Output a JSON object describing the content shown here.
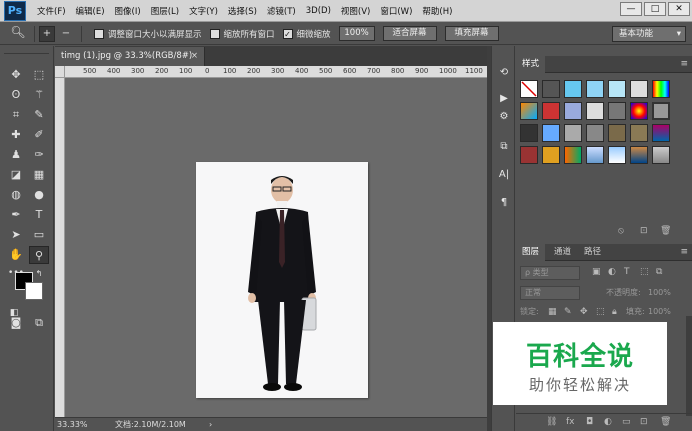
{
  "app": {
    "logo": "Ps"
  },
  "menu": [
    "文件(F)",
    "编辑(E)",
    "图像(I)",
    "图层(L)",
    "文字(Y)",
    "选择(S)",
    "滤镜(T)",
    "3D(D)",
    "视图(V)",
    "窗口(W)",
    "帮助(H)"
  ],
  "window_controls": {
    "minimize": "—",
    "maximize": "□",
    "close": "✕"
  },
  "options": {
    "resize_windows_label": "调整窗口大小以满屏显示",
    "resize_windows_checked": false,
    "zoom_all_label": "缩放所有窗口",
    "zoom_all_checked": false,
    "scrubby_zoom_label": "细微缩放",
    "scrubby_zoom_checked": true,
    "zoom_percent": "100%",
    "fit_screen_label": "适合屏幕",
    "fill_screen_label": "填充屏幕",
    "workspace": "基本功能"
  },
  "document": {
    "tab_title": "timg (1).jpg @ 33.3%(RGB/8#)",
    "ruler_ticks": [
      "500",
      "400",
      "300",
      "200",
      "100",
      "0",
      "100",
      "200",
      "300",
      "400",
      "500",
      "600",
      "700",
      "800",
      "900",
      "1000",
      "1100"
    ],
    "zoom": "33.33%",
    "doc_info": "文档:2.10M/2.10M",
    "arrow": "›"
  },
  "panels": {
    "styles_tab": "样式",
    "layers_tab": "图层",
    "channels_tab": "通道",
    "paths_tab": "路径",
    "kind_filter": "ρ 类型",
    "blend_mode": "正常",
    "opacity_label": "不透明度:",
    "opacity_value": "100%",
    "lock_label": "锁定:",
    "fill_label": "填充:",
    "fill_value": "100%"
  },
  "watermark": {
    "title": "百科全说",
    "subtitle": "助你轻松解决"
  },
  "colors": {
    "menubar": "#d4d4d4",
    "ui_dark": "#535353",
    "canvas": "#6a6a6a",
    "watermark_green": "#1aa84d"
  }
}
